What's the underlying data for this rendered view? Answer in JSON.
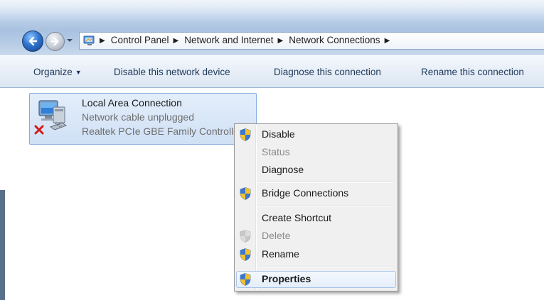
{
  "address_bar": {
    "crumbs": [
      "Control Panel",
      "Network and Internet",
      "Network Connections"
    ]
  },
  "command_bar": {
    "organize": "Organize",
    "disable_device": "Disable this network device",
    "diagnose": "Diagnose this connection",
    "rename": "Rename this connection"
  },
  "connection": {
    "name": "Local Area Connection",
    "status": "Network cable unplugged",
    "device": "Realtek PCIe GBE Family Controller"
  },
  "context_menu": {
    "items": [
      {
        "label": "Disable",
        "icon": "uac-shield-icon",
        "enabled": true
      },
      {
        "label": "Status",
        "enabled": false
      },
      {
        "label": "Diagnose",
        "enabled": true
      },
      {
        "label": "Bridge Connections",
        "icon": "uac-shield-icon",
        "enabled": true
      },
      {
        "label": "Create Shortcut",
        "enabled": true
      },
      {
        "label": "Delete",
        "icon": "uac-shield-icon",
        "enabled": false
      },
      {
        "label": "Rename",
        "icon": "uac-shield-icon",
        "enabled": true
      },
      {
        "label": "Properties",
        "icon": "uac-shield-icon",
        "enabled": true,
        "default": true,
        "highlighted": true
      }
    ]
  },
  "colors": {
    "titlebar": "#b8cde6",
    "command_text": "#1e395b",
    "selection": "#cfe0f5",
    "menu_background": "#f0f0f0"
  }
}
